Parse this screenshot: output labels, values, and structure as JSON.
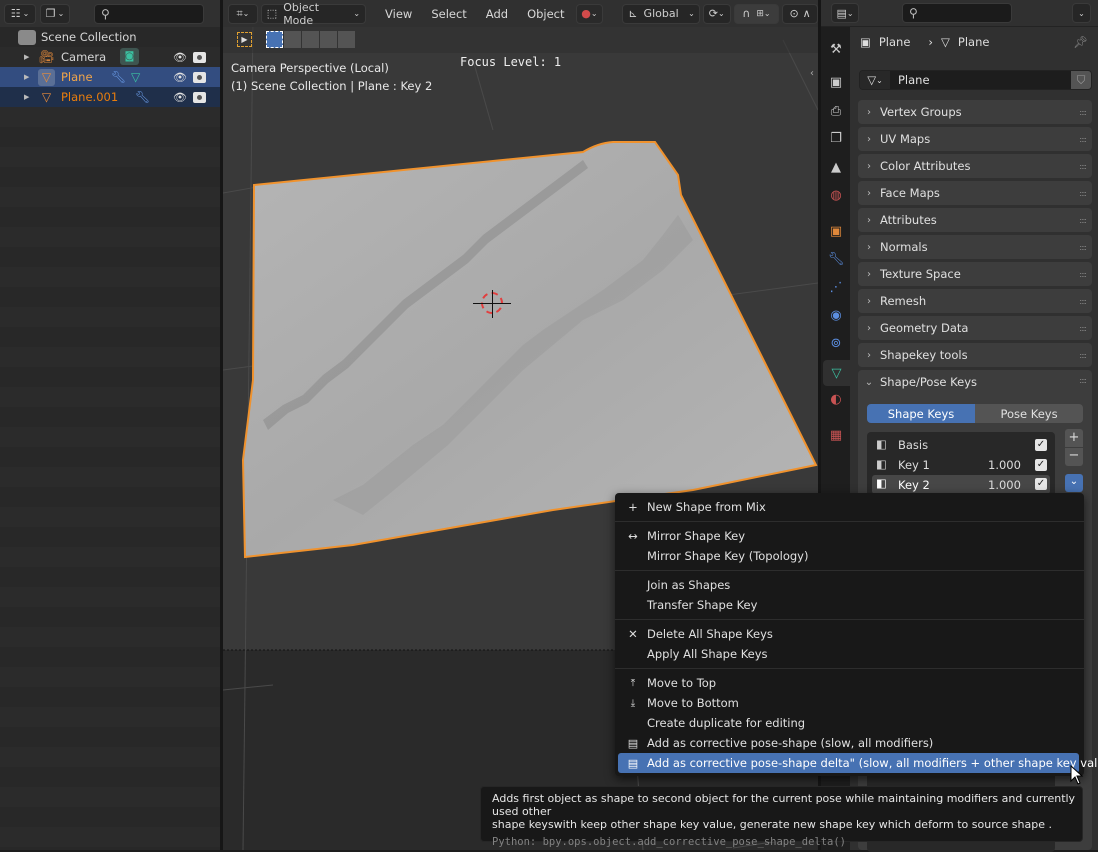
{
  "outliner": {
    "search_placeholder": "",
    "root": "Scene Collection",
    "items": [
      {
        "name": "Camera",
        "state": "normal"
      },
      {
        "name": "Plane",
        "state": "active"
      },
      {
        "name": "Plane.001",
        "state": "selected"
      }
    ]
  },
  "viewport": {
    "header": {
      "mode": "Object Mode",
      "menus": [
        "View",
        "Select",
        "Add",
        "Object"
      ],
      "transform_orientation": "Global"
    },
    "overlay": {
      "view_name": "Camera Perspective (Local)",
      "context": "(1) Scene Collection | Plane : Key 2",
      "focus_level": "Focus Level: 1"
    }
  },
  "properties": {
    "search_placeholder": "",
    "breadcrumb": {
      "object": "Plane",
      "data": "Plane"
    },
    "datablock_name": "Plane",
    "panels": [
      "Vertex Groups",
      "UV Maps",
      "Color Attributes",
      "Face Maps",
      "Attributes",
      "Normals",
      "Texture Space",
      "Remesh",
      "Geometry Data",
      "Shapekey tools"
    ],
    "shape_panel": {
      "title": "Shape/Pose Keys",
      "tabs": [
        "Shape Keys",
        "Pose Keys"
      ],
      "active_tab": "Shape Keys",
      "keys": [
        {
          "name": "Basis",
          "value": "",
          "checked": true
        },
        {
          "name": "Key 1",
          "value": "1.000",
          "checked": true
        },
        {
          "name": "Key 2",
          "value": "1.000",
          "checked": true
        }
      ],
      "active_key": "Key 2"
    }
  },
  "menu": {
    "items": [
      {
        "icon": "plus",
        "label": "New Shape from Mix"
      },
      {
        "icon": "mirror",
        "label": "Mirror Shape Key"
      },
      {
        "icon": "",
        "label": "Mirror Shape Key (Topology)"
      },
      {
        "icon": "",
        "label": "Join as Shapes"
      },
      {
        "icon": "",
        "label": "Transfer Shape Key"
      },
      {
        "icon": "x",
        "label": "Delete All Shape Keys"
      },
      {
        "icon": "",
        "label": "Apply All Shape Keys"
      },
      {
        "icon": "move-top",
        "label": "Move to Top"
      },
      {
        "icon": "move-bottom",
        "label": "Move to Bottom"
      },
      {
        "icon": "",
        "label": "Create duplicate for editing"
      },
      {
        "icon": "shapekey",
        "label": "Add as corrective pose-shape (slow, all modifiers)"
      },
      {
        "icon": "shapekey",
        "label": "Add as corrective pose-shape delta\" (slow, all modifiers + other shape key values)"
      }
    ],
    "highlighted": 11
  },
  "tooltip": {
    "line1": "Adds first object as shape to second object for the current pose while maintaining modifiers and currently used other",
    "line2": "shape keyswith keep other shape key value, generate new shape key which deform to source shape .",
    "python": "Python: bpy.ops.object.add_corrective_pose_shape_delta()"
  },
  "colors": {
    "accent": "#4772b3",
    "selection_outline": "#f0922d",
    "object_orange": "#e87d0d"
  }
}
